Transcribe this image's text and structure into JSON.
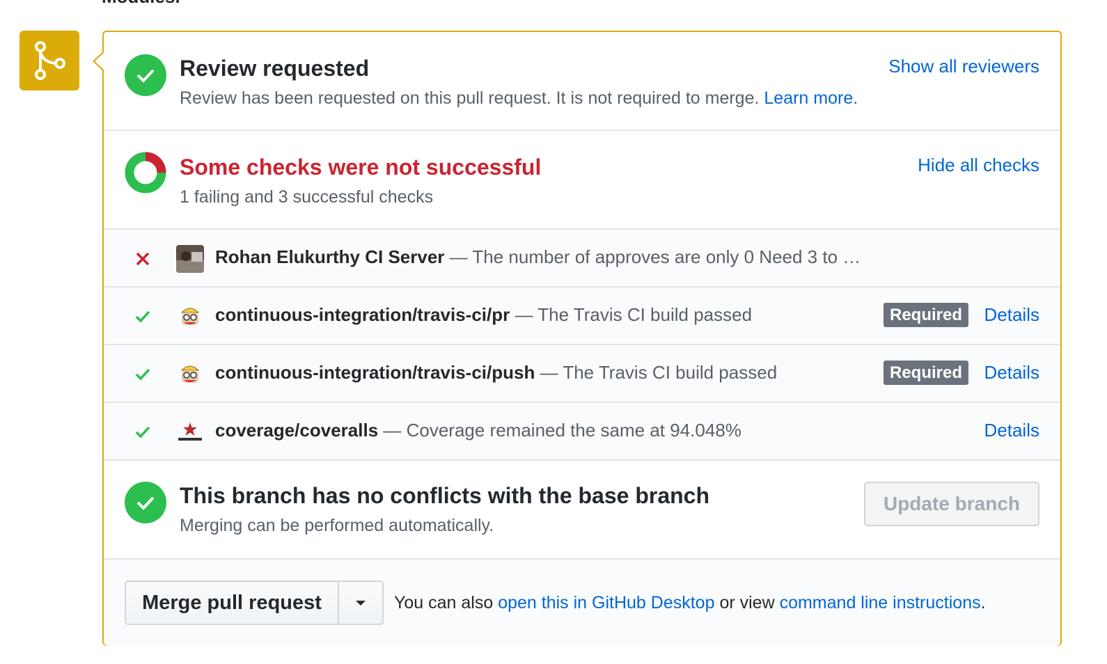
{
  "header_fragment": "Modules.",
  "colors": {
    "merge_icon_bg": "#dbab09",
    "success": "#2cbe4e",
    "failure": "#cb2431",
    "link": "#0366d6",
    "badge": "#6a737d"
  },
  "merge_icon": "git-merge-icon",
  "review": {
    "title": "Review requested",
    "description": "Review has been requested on this pull request. It is not required to merge.",
    "learn_more": "Learn more.",
    "show_all": "Show all reviewers"
  },
  "checks": {
    "title": "Some checks were not successful",
    "summary": "1 failing and 3 successful checks",
    "hide_all": "Hide all checks",
    "items": [
      {
        "status": "failure",
        "context": "Rohan Elukurthy CI Server",
        "description": " — The number of approves are only 0 Need 3 to …",
        "required": "",
        "details": ""
      },
      {
        "status": "success",
        "context": "continuous-integration/travis-ci/pr",
        "description": " — The Travis CI build passed",
        "required": "Required",
        "details": "Details"
      },
      {
        "status": "success",
        "context": "continuous-integration/travis-ci/push",
        "description": " — The Travis CI build passed",
        "required": "Required",
        "details": "Details"
      },
      {
        "status": "success",
        "context": "coverage/coveralls",
        "description": " — Coverage remained the same at 94.048%",
        "required": "",
        "details": "Details"
      }
    ]
  },
  "branch": {
    "title": "This branch has no conflicts with the base branch",
    "subtitle": "Merging can be performed automatically.",
    "update_button": "Update branch"
  },
  "merge": {
    "button": "Merge pull request",
    "note_prefix": "You can also",
    "desktop_link": "open this in GitHub Desktop",
    "note_middle": "or view",
    "cli_link": "command line instructions",
    "note_suffix": "."
  }
}
